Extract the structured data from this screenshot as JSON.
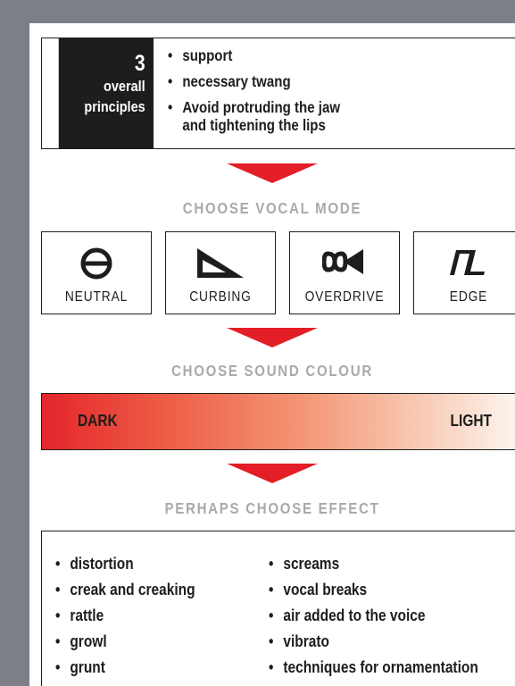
{
  "principles": {
    "number": "3",
    "label_line1": "overall",
    "label_line2": "principles",
    "items": [
      {
        "line1": "support"
      },
      {
        "line1": "necessary twang"
      },
      {
        "line1": "Avoid protruding the jaw",
        "line2": "and tightening the lips"
      }
    ]
  },
  "vocal_mode": {
    "title": "CHOOSE VOCAL MODE",
    "modes": [
      {
        "label": "NEUTRAL",
        "icon": "neutral-mode-icon"
      },
      {
        "label": "CURBING",
        "icon": "curbing-mode-icon"
      },
      {
        "label": "OVERDRIVE",
        "icon": "overdrive-mode-icon"
      },
      {
        "label": "EDGE",
        "icon": "edge-mode-icon"
      }
    ]
  },
  "sound_colour": {
    "title": "CHOOSE SOUND COLOUR",
    "dark_label": "DARK",
    "light_label": "LIGHT",
    "gradient_colors": [
      "#e5262b",
      "#fdf3ee"
    ]
  },
  "effect": {
    "title": "PERHAPS CHOOSE EFFECT",
    "col1": [
      "distortion",
      "creak and creaking",
      "rattle",
      "growl",
      "grunt"
    ],
    "col2": [
      "screams",
      "vocal breaks",
      "air added to the voice",
      "vibrato",
      "techniques for ornamentation"
    ]
  },
  "colors": {
    "accent_red": "#e31e26",
    "ink": "#1d1d1b",
    "title_gray": "#a9aaad",
    "background": "#7c7f85"
  }
}
